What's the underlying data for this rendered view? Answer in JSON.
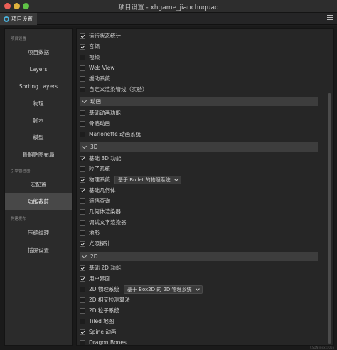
{
  "window": {
    "title": "项目设置 - xhgame_jianchuquao"
  },
  "tab": {
    "label": "项目设置",
    "icon": "gear-icon"
  },
  "menu": {
    "icon": "hamburger-menu-icon"
  },
  "sidebar": {
    "group1": "项目设置",
    "items1": [
      "项目数据",
      "Layers",
      "Sorting Layers",
      "物理",
      "脚本",
      "模型",
      "骨骼贴图布局"
    ],
    "group2": "引擎管理器",
    "items2": [
      "宏配置",
      "功能裁剪"
    ],
    "group3": "构建发布",
    "items3": [
      "压缩纹理",
      "插屏设置"
    ],
    "active": "功能裁剪"
  },
  "content": {
    "top_items": [
      {
        "label": "运行状态统计",
        "checked": true
      },
      {
        "label": "音频",
        "checked": true
      },
      {
        "label": "视频",
        "checked": false
      },
      {
        "label": "Web View",
        "checked": false
      },
      {
        "label": "缓动系统",
        "checked": false
      },
      {
        "label": "自定义渲染管线（实验）",
        "checked": false
      }
    ],
    "section_animation": {
      "title": "动画",
      "items": [
        {
          "label": "基础动画功能",
          "checked": false
        },
        {
          "label": "骨骼动画",
          "checked": false
        },
        {
          "label": "Marionette 动画系统",
          "checked": false
        }
      ]
    },
    "section_3d": {
      "title": "3D",
      "items": [
        {
          "label": "基础 3D 功能",
          "checked": true
        },
        {
          "label": "粒子系统",
          "checked": false
        },
        {
          "label": "物理系统",
          "checked": true
        },
        {
          "label": "基础几何体",
          "checked": true
        },
        {
          "label": "遮挡查询",
          "checked": false
        },
        {
          "label": "几何体渲染器",
          "checked": false
        },
        {
          "label": "调试文字渲染器",
          "checked": false
        },
        {
          "label": "地形",
          "checked": false
        },
        {
          "label": "光照探针",
          "checked": true
        }
      ],
      "physics_select": "基于 Bullet 的物理系统"
    },
    "section_2d": {
      "title": "2D",
      "items": [
        {
          "label": "基础 2D 功能",
          "checked": true
        },
        {
          "label": "用户界面",
          "checked": true
        },
        {
          "label": "2D 物理系统",
          "checked": false
        },
        {
          "label": "2D 相交检测算法",
          "checked": false
        },
        {
          "label": "2D 粒子系统",
          "checked": false
        },
        {
          "label": "Tiled 地图",
          "checked": false
        },
        {
          "label": "Spine 动画",
          "checked": true
        },
        {
          "label": "Dragon Bones",
          "checked": false
        }
      ],
      "physics_select": "基于 Box2D 的 2D 物理系统"
    }
  },
  "watermark": "CSDN @xxx1065"
}
